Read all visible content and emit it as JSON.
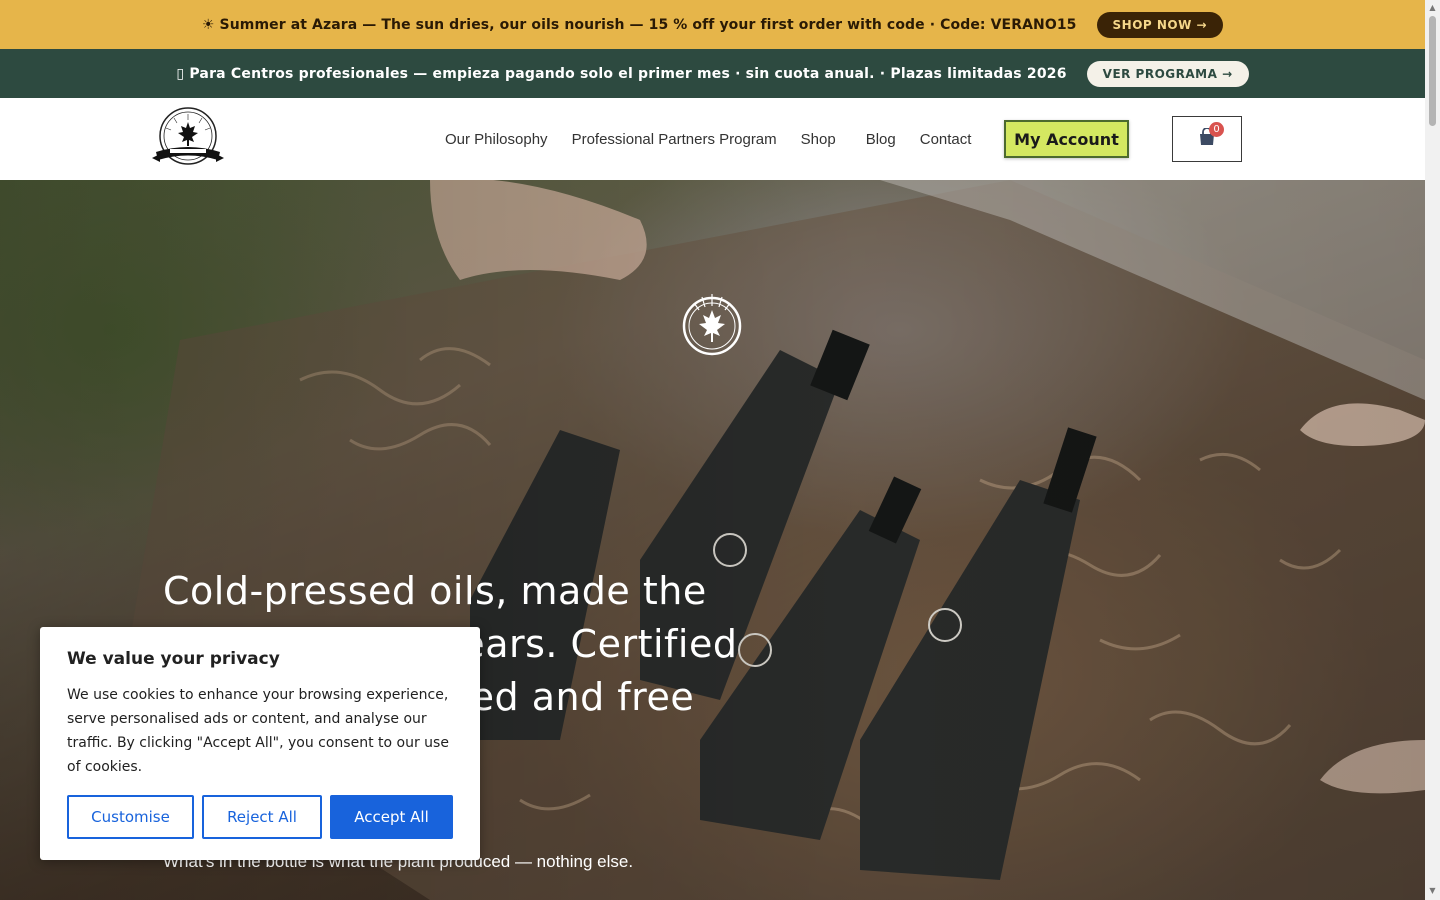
{
  "promo_bar": {
    "text": "☀ Summer at Azara — The sun dries, our oils nourish — 15 % off your first order with code  ·  Code: VERANO15",
    "button_label": "SHOP NOW →"
  },
  "pro_bar": {
    "text": "▯ Para Centros profesionales — empieza pagando solo el primer mes  ·  sin cuota anual.  ·  Plazas limitadas 2026",
    "button_label": "VER PROGRAMA →"
  },
  "nav": {
    "items": [
      {
        "label": "Our Philosophy"
      },
      {
        "label": "Professional Partners Program"
      },
      {
        "label": "Shop"
      },
      {
        "label": "Blog"
      },
      {
        "label": "Contact"
      }
    ],
    "account_label": "My Account",
    "cart_count": "0"
  },
  "hero": {
    "headline": "Cold-pressed oils, made the same way for years. Certified organic, unrefined and free of additions.",
    "subheadline": "What's in the bottle is what the plant produced — nothing else."
  },
  "cookie": {
    "title": "We value your privacy",
    "body": "We use cookies to enhance your browsing experience, serve personalised ads or content, and analyse our traffic. By clicking \"Accept All\", you consent to our use of cookies.",
    "customise_label": "Customise",
    "reject_label": "Reject All",
    "accept_label": "Accept All"
  },
  "colors": {
    "promo_bg": "#E6B54A",
    "pro_bg": "#2D4A40",
    "account_bg": "#D4E861",
    "cookie_accent": "#1863DC"
  },
  "icons": {
    "logo": "maple-leaf-emblem-icon",
    "cart": "shopping-bag-icon",
    "hero_emblem": "maple-leaf-sunburst-icon"
  }
}
